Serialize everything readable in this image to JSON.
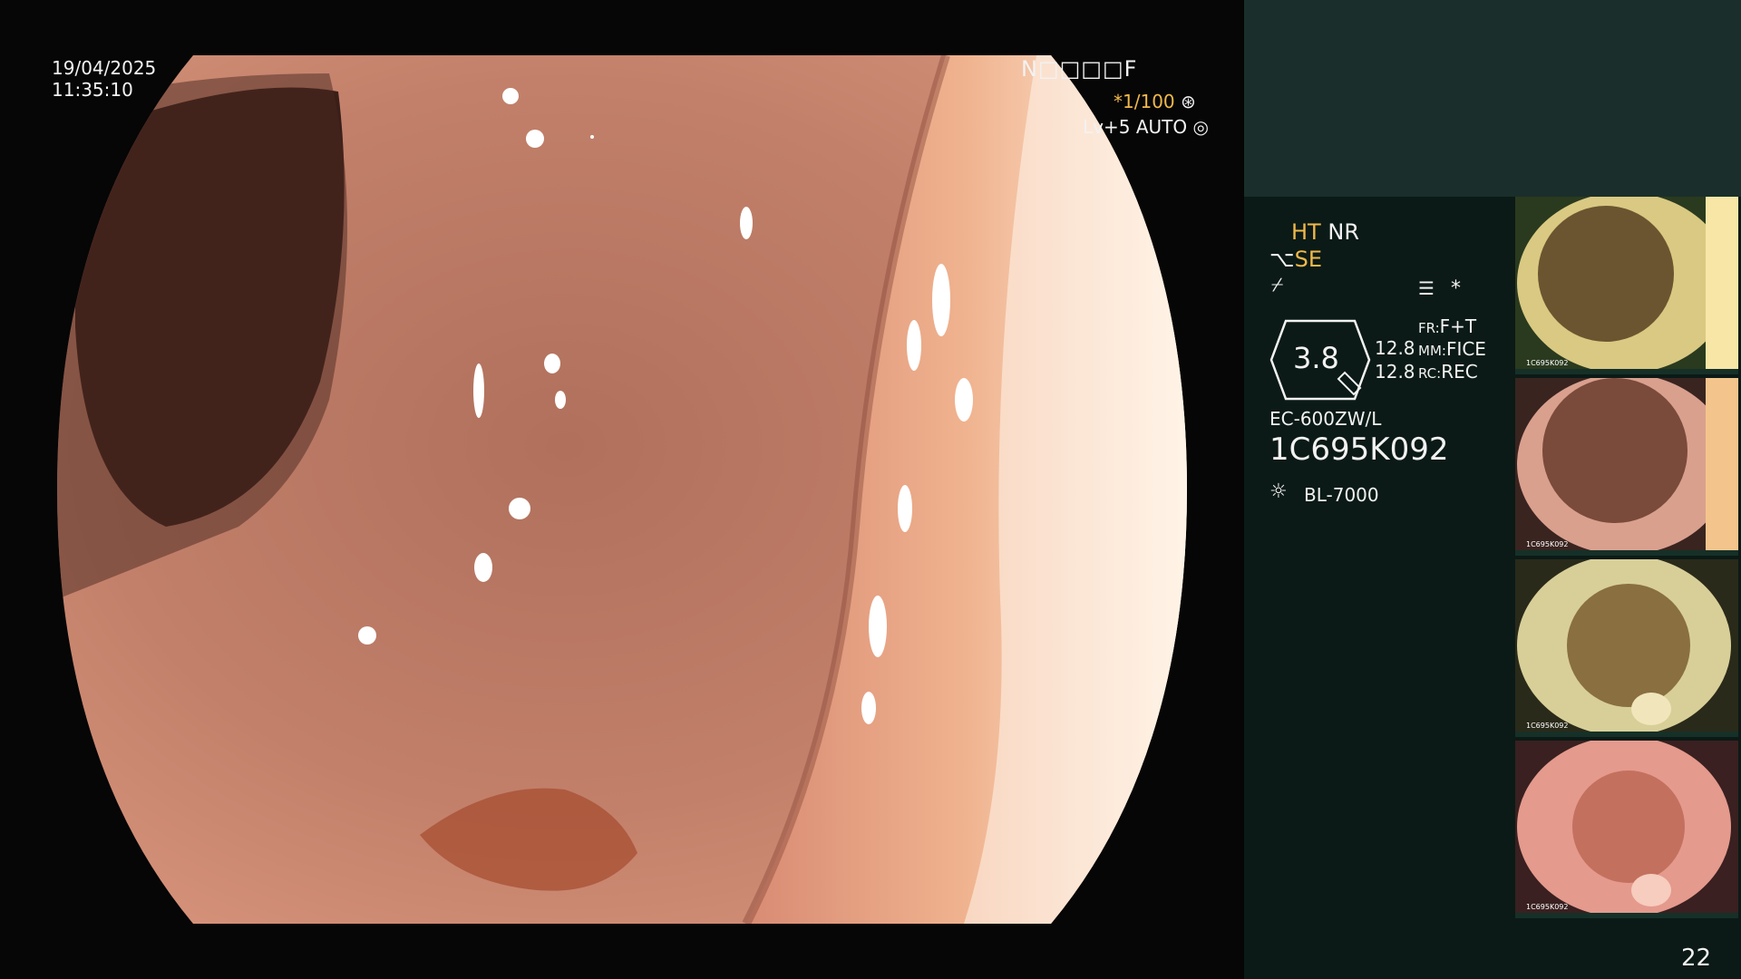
{
  "timestamp": {
    "date": "19/04/2025",
    "time": "11:35:10"
  },
  "top_right": {
    "code": "N□□□□F",
    "shutter": "*1/100",
    "shutter_icon": "aperture-icon",
    "level": "Lv+5 AUTO",
    "level_icon": "iris-icon"
  },
  "panel": {
    "ht": "HT",
    "nr": "NR",
    "se": "SE",
    "se_icon": "scope-tip-icon",
    "sub_icon": "freeze-icon",
    "menu_icon": "menu-icon",
    "asterisk": "*",
    "magnification": "3.8",
    "fr_label": "FR:",
    "fr_value": "F+T",
    "mm_label": "MM:",
    "mm_value": "FICE",
    "rc_label": "RC:",
    "rc_value": "REC",
    "val1": "12.8",
    "val2": "12.8",
    "scope_model": "EC-600ZW/L",
    "serial": "1C695K092",
    "light_source": "BL-7000",
    "light_icon": "lamp-icon",
    "page_number": "22"
  },
  "thumbnails": [
    {
      "name": "thumbnail-1",
      "tone": "yellowish",
      "serial": "1C695K092"
    },
    {
      "name": "thumbnail-2",
      "tone": "pink",
      "serial": "1C695K092"
    },
    {
      "name": "thumbnail-3",
      "tone": "pale-yellow",
      "serial": "1C695K092"
    },
    {
      "name": "thumbnail-4",
      "tone": "salmon",
      "serial": "1C695K092"
    }
  ],
  "colors": {
    "accent": "#f0b84b",
    "panel_bg": "#0b1a16",
    "panel_top": "#1a2f2b",
    "tissue": "#c67a64"
  }
}
